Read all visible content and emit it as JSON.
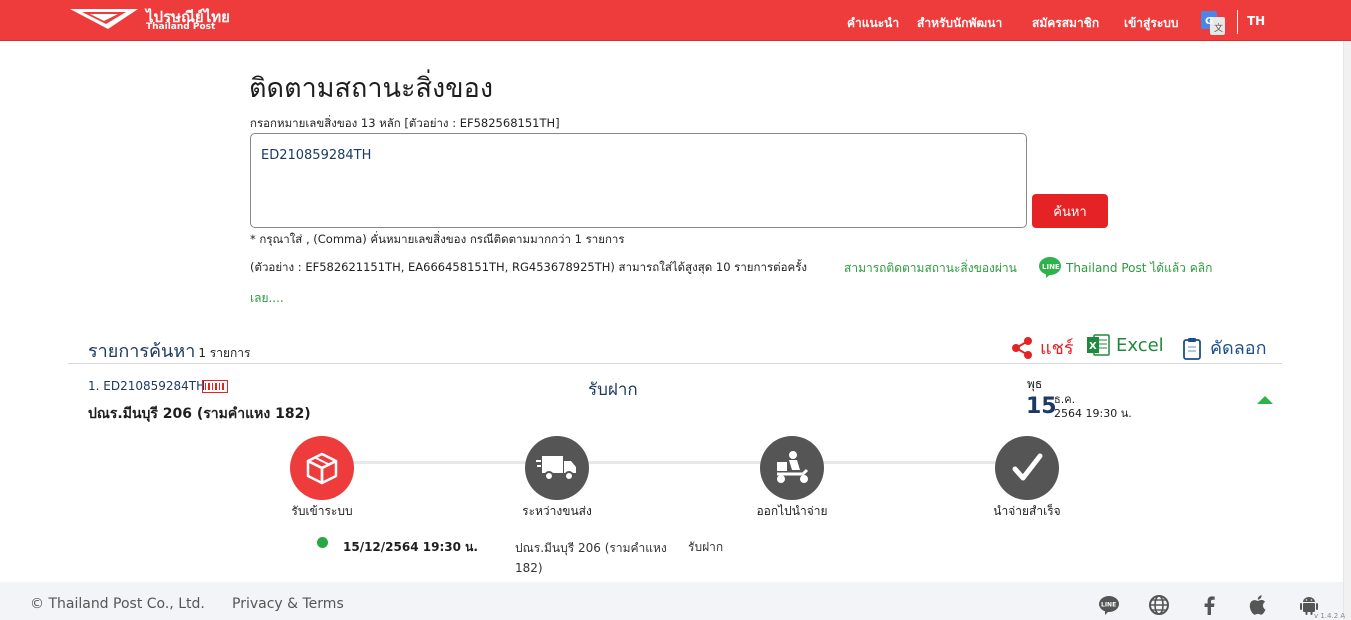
{
  "header": {
    "brand_th": "ไปรษณีย์ไทย",
    "brand_en": "Thailand Post",
    "nav": [
      "คำแนะนำ",
      "สำหรับนักพัฒนา",
      "สมัครสมาชิก",
      "เข้าสู่ระบบ"
    ],
    "language": "TH",
    "color": "#ee3b3b"
  },
  "search": {
    "title": "ติดตามสถานะสิ่งของ",
    "hint": "กรอกหมายเลขสิ่งของ 13 หลัก [ตัวอย่าง : EF582568151TH]",
    "input_value": "ED210859284TH",
    "button": "ค้นหา",
    "note1": "* กรุณาใส่ , (Comma) คั่นหมายเลขสิ่งของ กรณีติดตามมากกว่า 1 รายการ",
    "note2": "(ตัวอย่าง : EF582621151TH, EA666458151TH, RG453678925TH) สามารถใส่ได้สูงสุด 10 รายการต่อครั้ง",
    "line_text": "สามารถติดตามสถานะสิ่งของผ่าน",
    "line_text2": "Thailand Post ได้แล้ว คลิก",
    "line_text3": "เลย....",
    "line_icon": "line-icon"
  },
  "results": {
    "title": "รายการค้นหา",
    "count": "1 รายการ",
    "share": "แชร์",
    "excel": "Excel",
    "copy": "คัดลอก",
    "item": {
      "number": "1. ED210859284TH",
      "office": "ปณร.มีนบุรี 206 (รามคำแหง 182)",
      "status": "รับฝาก",
      "weekday": "พุธ",
      "day": "15",
      "month": "ธ.ค.",
      "year_time": "2564  19:30 น."
    },
    "steps": [
      {
        "label": "รับเข้าระบบ",
        "icon": "box-icon",
        "color": "#ee3b3b"
      },
      {
        "label": "ระหว่างขนส่ง",
        "icon": "truck-icon",
        "color": "#555555"
      },
      {
        "label": "ออกไปนำจ่าย",
        "icon": "scooter-icon",
        "color": "#555555"
      },
      {
        "label": "นำจ่ายสำเร็จ",
        "icon": "check-icon",
        "color": "#555555"
      }
    ],
    "events": [
      {
        "datetime": "15/12/2564 19:30 น.",
        "place": "ปณร.มีนบุรี 206 (รามคำแหง 182)",
        "status": "รับฝาก"
      }
    ]
  },
  "footer": {
    "copyright": "© Thailand Post Co., Ltd.",
    "privacy": "Privacy & Terms",
    "icons": [
      "line-icon",
      "globe-icon",
      "facebook-icon",
      "apple-icon",
      "android-icon"
    ],
    "version": "v 1.4.2 A"
  }
}
